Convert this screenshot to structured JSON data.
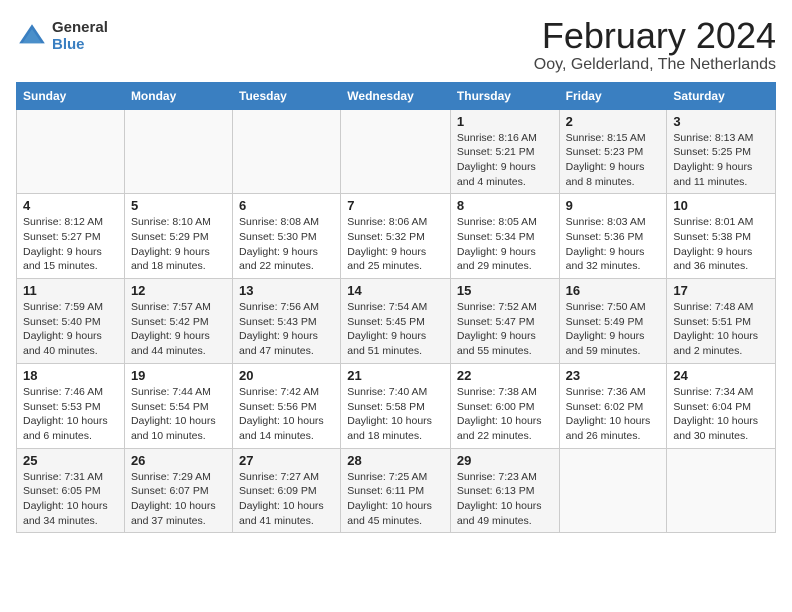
{
  "header": {
    "logo_general": "General",
    "logo_blue": "Blue",
    "title": "February 2024",
    "location": "Ooy, Gelderland, The Netherlands"
  },
  "weekdays": [
    "Sunday",
    "Monday",
    "Tuesday",
    "Wednesday",
    "Thursday",
    "Friday",
    "Saturday"
  ],
  "weeks": [
    [
      {
        "day": "",
        "info": ""
      },
      {
        "day": "",
        "info": ""
      },
      {
        "day": "",
        "info": ""
      },
      {
        "day": "",
        "info": ""
      },
      {
        "day": "1",
        "info": "Sunrise: 8:16 AM\nSunset: 5:21 PM\nDaylight: 9 hours\nand 4 minutes."
      },
      {
        "day": "2",
        "info": "Sunrise: 8:15 AM\nSunset: 5:23 PM\nDaylight: 9 hours\nand 8 minutes."
      },
      {
        "day": "3",
        "info": "Sunrise: 8:13 AM\nSunset: 5:25 PM\nDaylight: 9 hours\nand 11 minutes."
      }
    ],
    [
      {
        "day": "4",
        "info": "Sunrise: 8:12 AM\nSunset: 5:27 PM\nDaylight: 9 hours\nand 15 minutes."
      },
      {
        "day": "5",
        "info": "Sunrise: 8:10 AM\nSunset: 5:29 PM\nDaylight: 9 hours\nand 18 minutes."
      },
      {
        "day": "6",
        "info": "Sunrise: 8:08 AM\nSunset: 5:30 PM\nDaylight: 9 hours\nand 22 minutes."
      },
      {
        "day": "7",
        "info": "Sunrise: 8:06 AM\nSunset: 5:32 PM\nDaylight: 9 hours\nand 25 minutes."
      },
      {
        "day": "8",
        "info": "Sunrise: 8:05 AM\nSunset: 5:34 PM\nDaylight: 9 hours\nand 29 minutes."
      },
      {
        "day": "9",
        "info": "Sunrise: 8:03 AM\nSunset: 5:36 PM\nDaylight: 9 hours\nand 32 minutes."
      },
      {
        "day": "10",
        "info": "Sunrise: 8:01 AM\nSunset: 5:38 PM\nDaylight: 9 hours\nand 36 minutes."
      }
    ],
    [
      {
        "day": "11",
        "info": "Sunrise: 7:59 AM\nSunset: 5:40 PM\nDaylight: 9 hours\nand 40 minutes."
      },
      {
        "day": "12",
        "info": "Sunrise: 7:57 AM\nSunset: 5:42 PM\nDaylight: 9 hours\nand 44 minutes."
      },
      {
        "day": "13",
        "info": "Sunrise: 7:56 AM\nSunset: 5:43 PM\nDaylight: 9 hours\nand 47 minutes."
      },
      {
        "day": "14",
        "info": "Sunrise: 7:54 AM\nSunset: 5:45 PM\nDaylight: 9 hours\nand 51 minutes."
      },
      {
        "day": "15",
        "info": "Sunrise: 7:52 AM\nSunset: 5:47 PM\nDaylight: 9 hours\nand 55 minutes."
      },
      {
        "day": "16",
        "info": "Sunrise: 7:50 AM\nSunset: 5:49 PM\nDaylight: 9 hours\nand 59 minutes."
      },
      {
        "day": "17",
        "info": "Sunrise: 7:48 AM\nSunset: 5:51 PM\nDaylight: 10 hours\nand 2 minutes."
      }
    ],
    [
      {
        "day": "18",
        "info": "Sunrise: 7:46 AM\nSunset: 5:53 PM\nDaylight: 10 hours\nand 6 minutes."
      },
      {
        "day": "19",
        "info": "Sunrise: 7:44 AM\nSunset: 5:54 PM\nDaylight: 10 hours\nand 10 minutes."
      },
      {
        "day": "20",
        "info": "Sunrise: 7:42 AM\nSunset: 5:56 PM\nDaylight: 10 hours\nand 14 minutes."
      },
      {
        "day": "21",
        "info": "Sunrise: 7:40 AM\nSunset: 5:58 PM\nDaylight: 10 hours\nand 18 minutes."
      },
      {
        "day": "22",
        "info": "Sunrise: 7:38 AM\nSunset: 6:00 PM\nDaylight: 10 hours\nand 22 minutes."
      },
      {
        "day": "23",
        "info": "Sunrise: 7:36 AM\nSunset: 6:02 PM\nDaylight: 10 hours\nand 26 minutes."
      },
      {
        "day": "24",
        "info": "Sunrise: 7:34 AM\nSunset: 6:04 PM\nDaylight: 10 hours\nand 30 minutes."
      }
    ],
    [
      {
        "day": "25",
        "info": "Sunrise: 7:31 AM\nSunset: 6:05 PM\nDaylight: 10 hours\nand 34 minutes."
      },
      {
        "day": "26",
        "info": "Sunrise: 7:29 AM\nSunset: 6:07 PM\nDaylight: 10 hours\nand 37 minutes."
      },
      {
        "day": "27",
        "info": "Sunrise: 7:27 AM\nSunset: 6:09 PM\nDaylight: 10 hours\nand 41 minutes."
      },
      {
        "day": "28",
        "info": "Sunrise: 7:25 AM\nSunset: 6:11 PM\nDaylight: 10 hours\nand 45 minutes."
      },
      {
        "day": "29",
        "info": "Sunrise: 7:23 AM\nSunset: 6:13 PM\nDaylight: 10 hours\nand 49 minutes."
      },
      {
        "day": "",
        "info": ""
      },
      {
        "day": "",
        "info": ""
      }
    ]
  ]
}
